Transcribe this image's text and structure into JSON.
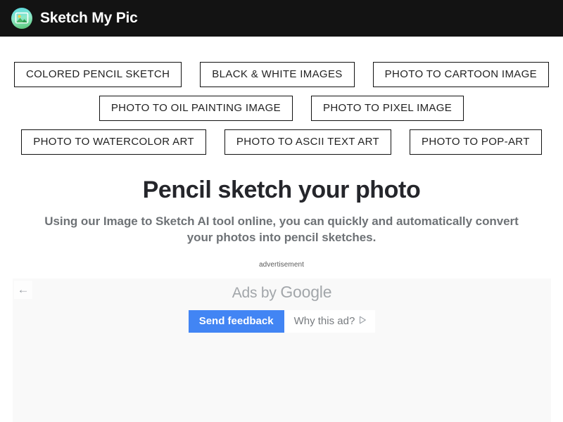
{
  "header": {
    "site_title": "Sketch My Pic",
    "logo_icon": "photo-landscape-icon",
    "background_color": "#131313",
    "logo_gradient_from": "#55d6e0",
    "logo_gradient_to": "#57c472"
  },
  "categories": {
    "rows": [
      [
        {
          "label": "COLORED PENCIL SKETCH"
        },
        {
          "label": "BLACK & WHITE IMAGES"
        },
        {
          "label": "PHOTO TO CARTOON IMAGE"
        }
      ],
      [
        {
          "label": "PHOTO TO OIL PAINTING IMAGE"
        },
        {
          "label": "PHOTO TO PIXEL IMAGE"
        }
      ],
      [
        {
          "label": "PHOTO TO WATERCOLOR ART"
        },
        {
          "label": "PHOTO TO ASCII TEXT ART"
        },
        {
          "label": "PHOTO TO POP-ART"
        }
      ]
    ]
  },
  "hero": {
    "title": "Pencil sketch your photo",
    "subtitle": "Using our Image to Sketch AI tool online, you can quickly and automatically convert your photos into pencil sketches.",
    "title_color": "#25262b",
    "subtitle_color": "#6e7276"
  },
  "ad": {
    "label": "advertisement",
    "attribution_prefix": "Ads by ",
    "attribution_brand": "Google",
    "back_arrow_icon": "arrow-left-icon",
    "send_feedback_label": "Send feedback",
    "why_this_ad_label": "Why this ad?",
    "why_this_ad_icon": "triangle-play-icon",
    "feedback_button_color": "#4285f4",
    "panel_background": "#f9f9f9"
  }
}
